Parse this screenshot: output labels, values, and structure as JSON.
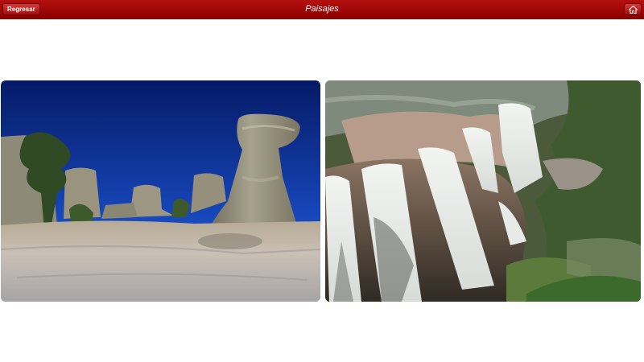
{
  "header": {
    "back_label": "Regresar",
    "title": "Paisajes",
    "home_icon": "home-icon"
  },
  "colors": {
    "header_bar": "#a40808",
    "background": "#ffffff"
  },
  "gallery": {
    "photos": [
      {
        "subject": "rock-formations"
      },
      {
        "subject": "waterfall"
      }
    ]
  }
}
